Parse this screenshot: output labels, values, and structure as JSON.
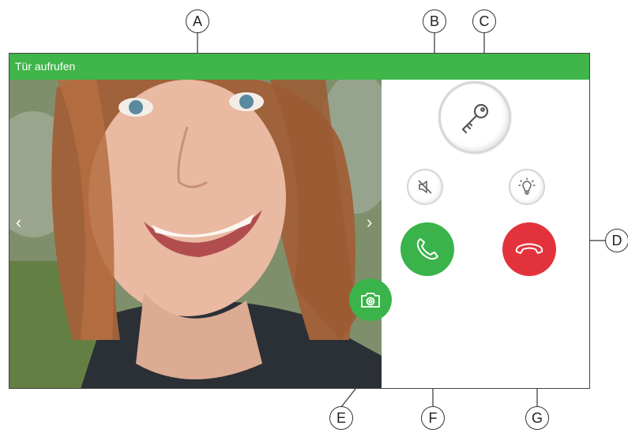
{
  "window": {
    "title": "Tür aufrufen"
  },
  "video": {
    "nav_prev": "‹",
    "nav_next": "›"
  },
  "buttons": {
    "unlock": "key-icon",
    "mute": "speaker-mute-icon",
    "light": "light-bulb-icon",
    "accept_call": "phone-icon",
    "hang_up": "phone-hangup-icon",
    "snapshot": "camera-icon"
  },
  "colors": {
    "accent": "#3fb54a",
    "hangup": "#e2333c"
  },
  "callouts": {
    "a": "A",
    "b": "B",
    "c": "C",
    "d": "D",
    "e": "E",
    "f": "F",
    "g": "G"
  }
}
